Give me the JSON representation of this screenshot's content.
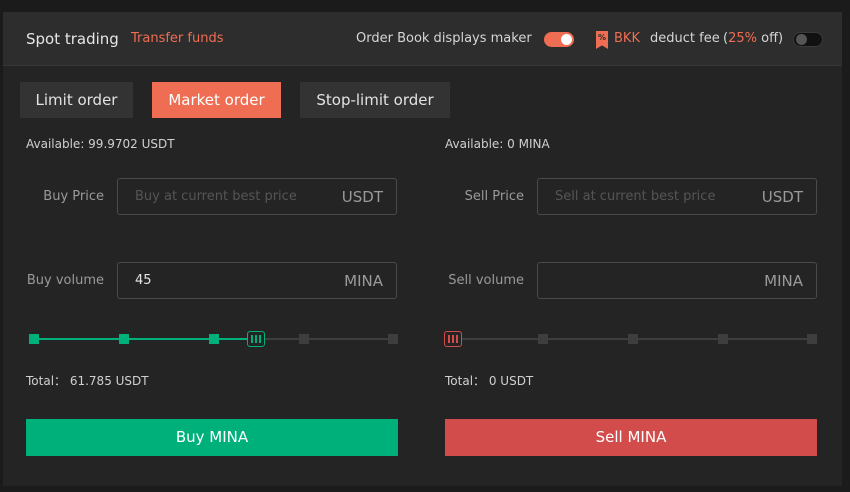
{
  "header": {
    "title": "Spot trading",
    "transfer_link": "Transfer funds",
    "order_book_label": "Order Book displays maker",
    "order_book_toggle": true,
    "bkk_icon_text": "%",
    "bkk_label": "BKK",
    "deduct_label": "deduct fee",
    "discount_open": "(",
    "discount_pct": "25%",
    "discount_close": " off)",
    "bkk_toggle": false
  },
  "tabs": [
    {
      "label": "Limit order",
      "active": false
    },
    {
      "label": "Market order",
      "active": true
    },
    {
      "label": "Stop-limit order",
      "active": false
    }
  ],
  "buy": {
    "available": "Available: 99.9702  USDT",
    "price_label": "Buy Price",
    "price_placeholder": "Buy at current best price",
    "price_unit": "USDT",
    "volume_label": "Buy volume",
    "volume_value": "45",
    "volume_unit": "MINA",
    "slider_percent": 61.785,
    "total": "Total：  61.785 USDT",
    "button": "Buy MINA"
  },
  "sell": {
    "available": "Available: 0  MINA",
    "price_label": "Sell Price",
    "price_placeholder": "Sell at current best price",
    "price_unit": "USDT",
    "volume_label": "Sell volume",
    "volume_value": "",
    "volume_unit": "MINA",
    "slider_percent": 0,
    "total": "Total：  0 USDT",
    "button": "Sell MINA"
  },
  "colors": {
    "accent": "#ef6d52",
    "buy": "#00b07b",
    "sell": "#d24c4c",
    "background": "#242424"
  }
}
